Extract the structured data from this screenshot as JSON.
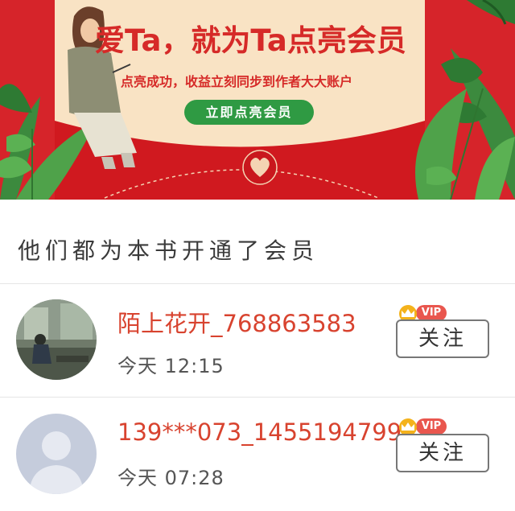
{
  "banner": {
    "headline": "爱Ta，就为Ta点亮会员",
    "subline": "点亮成功，收益立刻同步到作者大大账户",
    "cta_label": "立即点亮会员"
  },
  "section": {
    "title": "他们都为本书开通了会员"
  },
  "members": [
    {
      "name": "陌上花开_768863583",
      "time": "今天 12:15",
      "badge": "VIP",
      "follow_label": "关注"
    },
    {
      "name": "139***073_1455194799",
      "time": "今天 07:28",
      "badge": "VIP",
      "follow_label": "关注"
    }
  ],
  "colors": {
    "banner_red": "#d6242a",
    "card_cream": "#f9e3c4",
    "cta_green": "#2f9a43",
    "name_red": "#d8432f",
    "vip_red": "#e9564e"
  }
}
